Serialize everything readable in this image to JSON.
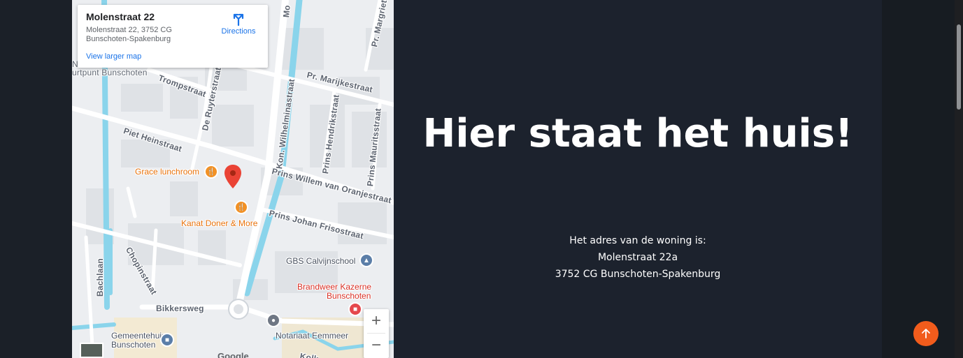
{
  "map": {
    "card": {
      "title": "Molenstraat 22",
      "address_line1": "Molenstraat 22, 3752 CG",
      "address_line2": "Bunschoten-Spakenburg",
      "view_larger": "View larger map",
      "directions": "Directions"
    },
    "streets": {
      "trompstraat": "Trompstraat",
      "ruyterstraat": "De Ruyterstraat",
      "wilhelminastraat": "Kon. Wilhelminastraat",
      "marijkestraat": "Pr. Marijkestraat",
      "hendrikstraat": "Prins Hendrikstraat",
      "mauritsstraat": "Prins Mauritsstraat",
      "margriet": "Pr. Margriet",
      "piet_heinstraat": "Piet Heinstraat",
      "willem_van_oranjestraat": "Prins Willem van Oranjestraat",
      "johan_frisostraat": "Prins Johan Frisostraat",
      "chopinstraat": "Chopinstraat",
      "bachlaan": "Bachlaan",
      "bikkersweg": "Bikkersweg",
      "kolk": "Kolk",
      "top_fragment": "Mo",
      "left_fragment_1": "N",
      "left_fragment_2": "urtpunt Bunschoten"
    },
    "pois": {
      "grace": "Grace lunchroom",
      "kanat": "Kanat Doner & More",
      "gbs": "GBS Calvijnschool",
      "brandweer_1": "Brandweer Kazerne",
      "brandweer_2": "Bunschoten",
      "gemeentehuis_1": "Gemeentehuis",
      "gemeentehuis_2": "Bunschoten",
      "notariaat": "Notariaat Eemmeer"
    },
    "zoom_in": "+",
    "zoom_out": "−",
    "google": "Google"
  },
  "hero": {
    "heading": "Hier staat het huis!",
    "address_label": "Het adres van de woning is:",
    "street": "Molenstraat 22a",
    "city": "3752 CG Bunschoten-Spakenburg"
  },
  "colors": {
    "hero_bg": "#1c222d",
    "accent": "#f25c1c",
    "water": "#8ad4eb"
  },
  "icons": {
    "directions": "directions-icon",
    "to_top": "arrow-up-icon",
    "pin": "map-marker-icon"
  }
}
